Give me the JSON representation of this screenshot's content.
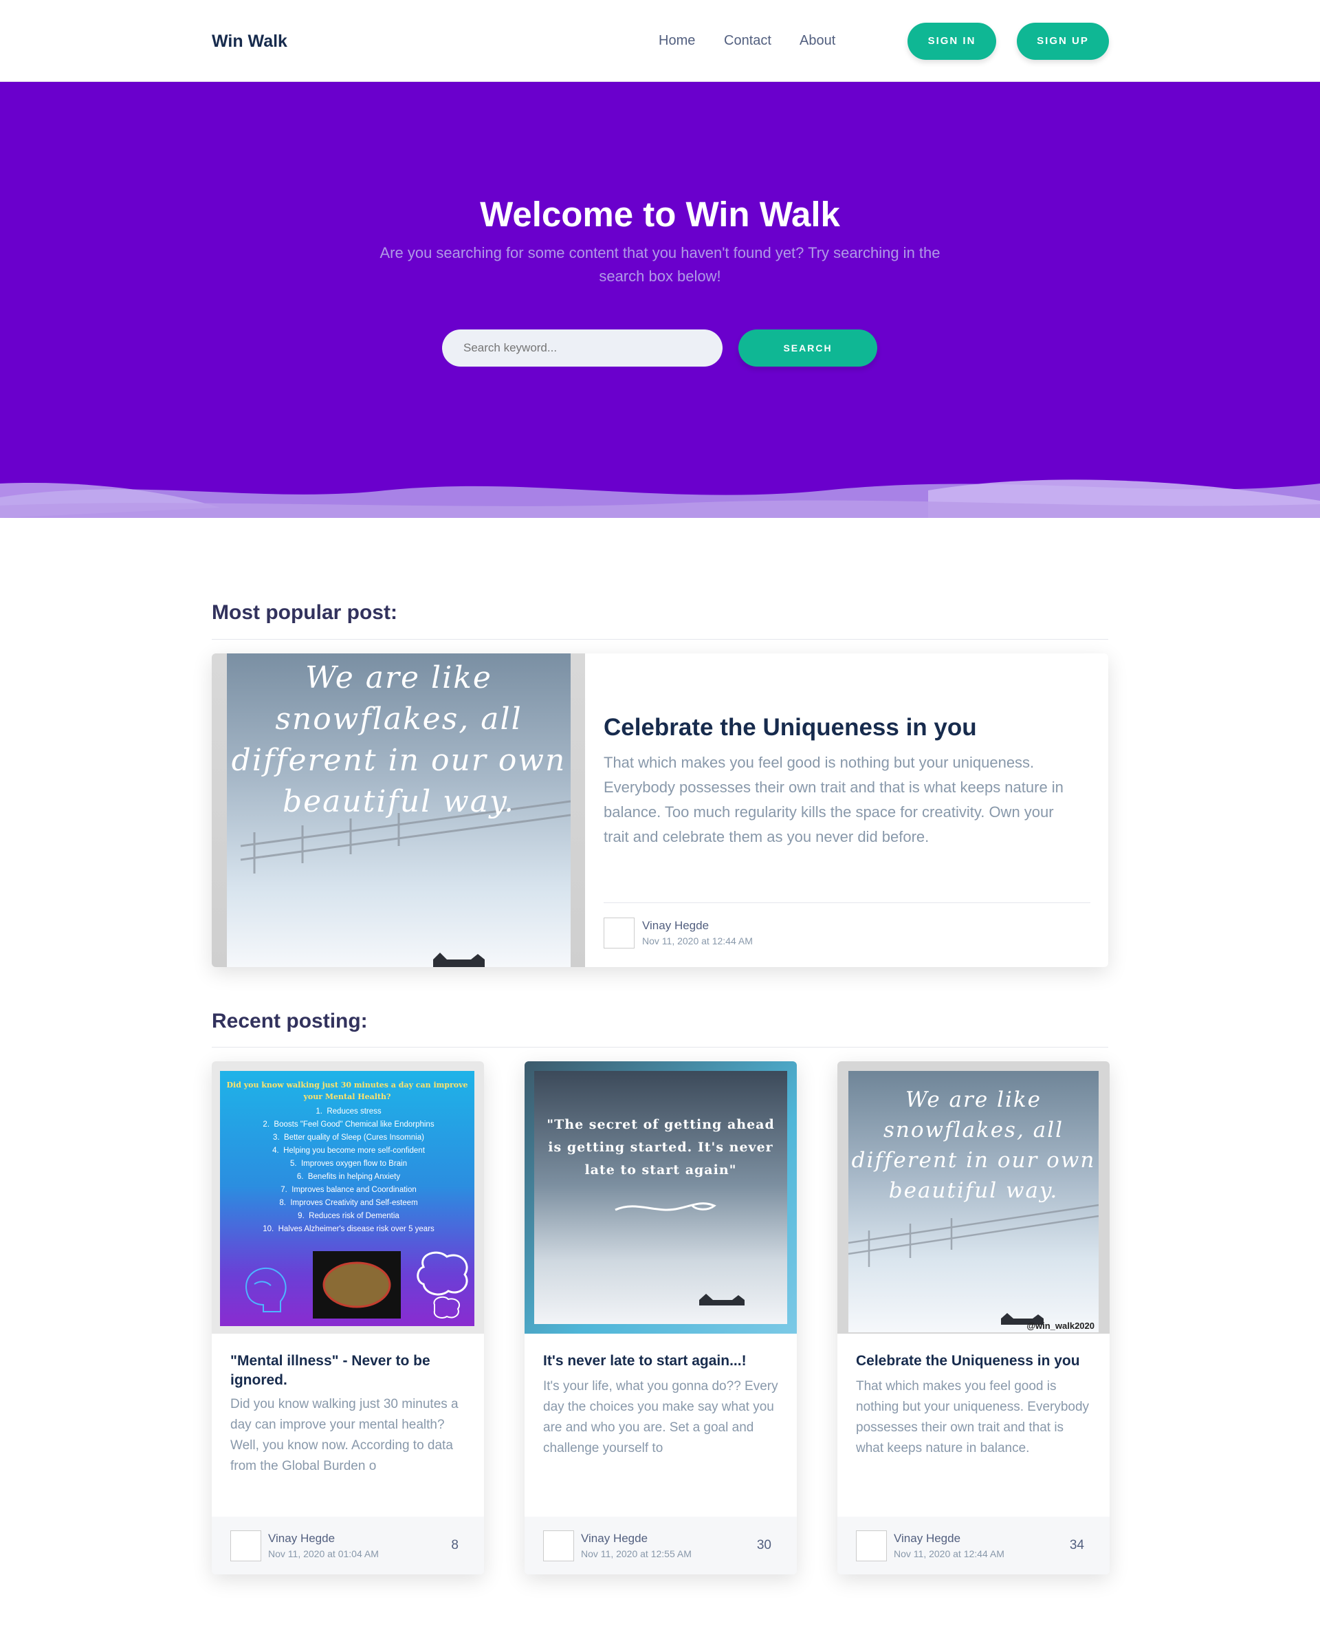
{
  "nav": {
    "brand": "Win Walk",
    "links": [
      "Home",
      "Contact",
      "About"
    ],
    "sign_in": "SIGN IN",
    "sign_up": "SIGN UP"
  },
  "hero": {
    "title": "Welcome to Win Walk",
    "subtitle": "Are you searching for some content that you haven't found yet? Try searching in the search box below!",
    "search_placeholder": "Search keyword...",
    "search_button": "SEARCH"
  },
  "popular": {
    "heading": "Most popular post:",
    "image_quote_lines": [
      "We are like",
      "snowflakes, all",
      "different in our own",
      "beautiful way."
    ],
    "title": "Celebrate the Uniqueness in you",
    "text": "That which makes you feel good is nothing but your uniqueness. Everybody possesses their own trait and that is what keeps nature in balance. Too much regularity kills the space for creativity. Own your trait and celebrate them as you never did before.",
    "author": "Vinay Hegde",
    "date": "Nov 11, 2020 at 12:44 AM"
  },
  "recent": {
    "heading": "Recent posting:",
    "posts": [
      {
        "title": "\"Mental illness\" - Never to be ignored.",
        "text": "Did you know walking just 30 minutes a day can improve your mental health? Well, you know now. According to data from the Global Burden o",
        "author": "Vinay Hegde",
        "date": "Nov 11, 2020 at 01:04 AM",
        "count": "8",
        "image_heading": "Did you know walking just 30 minutes a day can improve your Mental Health?",
        "image_list": [
          "Reduces stress",
          "Boosts \"Feel Good\" Chemical like Endorphins",
          "Better quality of Sleep (Cures Insomnia)",
          "Helping you become more self-confident",
          "Improves oxygen flow to Brain",
          "Benefits in helping Anxiety",
          "Improves balance and Coordination",
          "Improves Creativity and Self-esteem",
          "Reduces risk of Dementia",
          "Halves Alzheimer's disease risk over 5 years"
        ]
      },
      {
        "title": "It's never late to start again...!",
        "text": "It's your life, what you gonna do?? Every day the choices you make say what you are and who you are. Set a goal and challenge yourself to",
        "author": "Vinay Hegde",
        "date": "Nov 11, 2020 at 12:55 AM",
        "count": "30",
        "image_quote": "\"The secret of getting ahead is getting started. It's never late to start again\""
      },
      {
        "title": "Celebrate the Uniqueness in you",
        "text": "That which makes you feel good is nothing but your uniqueness. Everybody possesses their own trait and that is what keeps nature in balance.",
        "author": "Vinay Hegde",
        "date": "Nov 11, 2020 at 12:44 AM",
        "count": "34",
        "image_quote_lines": [
          "We are like",
          "snowflakes, all",
          "different in our own",
          "beautiful way."
        ],
        "watermark": "@win_walk2020"
      }
    ]
  },
  "colors": {
    "hero_bg": "#6a00cc",
    "accent": "#0fb794"
  }
}
